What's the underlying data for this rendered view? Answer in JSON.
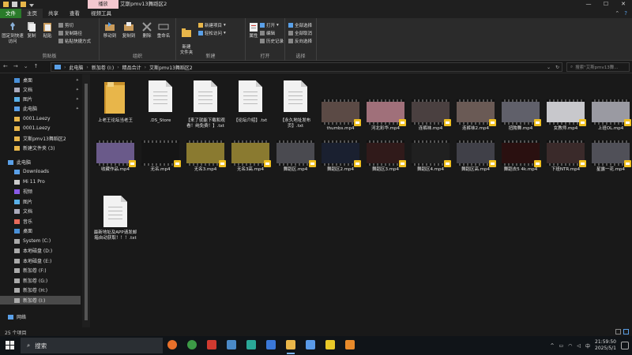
{
  "titlebar": {
    "context_tab": "播放",
    "title": "艾斯pmv13舞蹈区2",
    "minimize": "—",
    "maximize": "☐",
    "close": "✕"
  },
  "ribbon_tabs": [
    "文件",
    "主页",
    "共享",
    "查看",
    "视频工具"
  ],
  "ribbon": {
    "clipboard": {
      "pin": "固定到快速访问",
      "copy": "复制",
      "paste": "粘贴",
      "cut": "剪切",
      "copy_path": "复制路径",
      "paste_shortcut": "粘贴快捷方式",
      "label": "剪贴板"
    },
    "organize": {
      "move_to": "移动到",
      "copy_to": "复制到",
      "delete": "删除",
      "rename": "重命名",
      "label": "组织"
    },
    "new": {
      "new_folder": "新建\n文件夹",
      "new_item": "新建项目",
      "easy_access": "轻松访问",
      "label": "新建"
    },
    "open": {
      "properties": "属性",
      "open": "打开",
      "edit": "编辑",
      "history": "历史记录",
      "label": "打开"
    },
    "select": {
      "select_all": "全部选择",
      "select_none": "全部取消",
      "invert": "反向选择",
      "label": "选择"
    }
  },
  "address": {
    "crumbs": [
      "此电脑",
      "新加卷 (I:)",
      "精品合计",
      "艾斯pmv13舞蹈区2"
    ],
    "search_placeholder": "搜索\"艾斯pmv13舞..."
  },
  "nav": [
    {
      "label": "桌面",
      "pinned": true,
      "icon": "desktop"
    },
    {
      "label": "文档",
      "pinned": true,
      "icon": "doc"
    },
    {
      "label": "图片",
      "pinned": true,
      "icon": "pic"
    },
    {
      "label": "此电脑",
      "pinned": true,
      "icon": "pc"
    },
    {
      "label": "0001.Leezy",
      "pinned": false,
      "icon": "folder"
    },
    {
      "label": "0001.Leezy",
      "pinned": false,
      "icon": "folder"
    },
    {
      "label": "艾斯pmv13舞蹈区2",
      "pinned": false,
      "icon": "folder"
    },
    {
      "label": "新建文件夹 (3)",
      "pinned": false,
      "icon": "folder"
    },
    {
      "label": "此电脑",
      "pinned": false,
      "icon": "pc"
    },
    {
      "label": "Downloads",
      "pinned": false,
      "icon": "dl"
    },
    {
      "label": "Mi 11 Pro",
      "pinned": false,
      "icon": "phone"
    },
    {
      "label": "视频",
      "pinned": false,
      "icon": "video"
    },
    {
      "label": "图片",
      "pinned": false,
      "icon": "pic"
    },
    {
      "label": "文档",
      "pinned": false,
      "icon": "doc"
    },
    {
      "label": "音乐",
      "pinned": false,
      "icon": "music"
    },
    {
      "label": "桌面",
      "pinned": false,
      "icon": "desktop"
    },
    {
      "label": "System (C:)",
      "pinned": false,
      "icon": "drive"
    },
    {
      "label": "本地磁盘 (D:)",
      "pinned": false,
      "icon": "drive"
    },
    {
      "label": "本地磁盘 (E:)",
      "pinned": false,
      "icon": "drive"
    },
    {
      "label": "新加卷 (F:)",
      "pinned": false,
      "icon": "drive"
    },
    {
      "label": "新加卷 (G:)",
      "pinned": false,
      "icon": "drive"
    },
    {
      "label": "新加卷 (H:)",
      "pinned": false,
      "icon": "drive"
    },
    {
      "label": "新加卷 (I:)",
      "pinned": false,
      "icon": "drive",
      "selected": true
    },
    {
      "label": "网络",
      "pinned": false,
      "icon": "net"
    }
  ],
  "files": [
    {
      "name": "上老王论坛当老王",
      "type": "folder"
    },
    {
      "name": ".DS_Store",
      "type": "doc"
    },
    {
      "name": "【来了就能下载和观看！纯免费！】.txt",
      "type": "doc"
    },
    {
      "name": "【论坛介绍】.txt",
      "type": "doc"
    },
    {
      "name": "【永久地址发布页】.txt",
      "type": "doc"
    },
    {
      "name": "thumbs.mp4",
      "type": "video",
      "color": "#5b4a45"
    },
    {
      "name": "河北彩华.mp4",
      "type": "video",
      "color": "#a0707a"
    },
    {
      "name": "连裤袜.mp4",
      "type": "video",
      "color": "#4a4040"
    },
    {
      "name": "连裤袜2.mp4",
      "type": "video",
      "color": "#6a5a55"
    },
    {
      "name": "扭胯舞.mp4",
      "type": "video",
      "color": "#60606a"
    },
    {
      "name": "女教师.mp4",
      "type": "video",
      "color": "#c8c8cc"
    },
    {
      "name": "上班OL.mp4",
      "type": "video",
      "color": "#9a9aa2"
    },
    {
      "name": "收藏作品.mp4",
      "type": "video",
      "color": "#6a5a8a"
    },
    {
      "name": "无名.mp4",
      "type": "video",
      "color": "#151515"
    },
    {
      "name": "无名3.mp4",
      "type": "video",
      "color": "#8a7a30"
    },
    {
      "name": "无名3高.mp4",
      "type": "video",
      "color": "#8a7a30"
    },
    {
      "name": "舞蹈区.mp4",
      "type": "video",
      "color": "#4a4a50"
    },
    {
      "name": "舞蹈区2.mp4",
      "type": "video",
      "color": "#1a2030"
    },
    {
      "name": "舞蹈区3.mp4",
      "type": "video",
      "color": "#301a1a"
    },
    {
      "name": "舞蹈区4.mp4",
      "type": "video",
      "color": "#202020"
    },
    {
      "name": "舞蹈区高.mp4",
      "type": "video",
      "color": "#404048"
    },
    {
      "name": "舞蹈去5 4k.mp4",
      "type": "video",
      "color": "#2a1010"
    },
    {
      "name": "下班NTR.mp4",
      "type": "video",
      "color": "#3a2a2a"
    },
    {
      "name": "星露一花.mp4",
      "type": "video",
      "color": "#505058"
    },
    {
      "name": "最新地址及APP请发邮箱自动获取！！！.txt",
      "type": "doc"
    }
  ],
  "status": {
    "count": "25 个项目"
  },
  "taskbar": {
    "search_label": "搜索",
    "apps": [
      {
        "name": "firefox",
        "color": "#e8702a"
      },
      {
        "name": "chrome",
        "color": "#3c9a46"
      },
      {
        "name": "app-red",
        "color": "#d03a30"
      },
      {
        "name": "app-keyboard",
        "color": "#4a8ac8"
      },
      {
        "name": "app-teal",
        "color": "#2aa898"
      },
      {
        "name": "app-blue",
        "color": "#3a78d8"
      },
      {
        "name": "explorer",
        "color": "#e8b64a",
        "active": true
      },
      {
        "name": "app-link",
        "color": "#5a9ae8"
      },
      {
        "name": "app-yellow",
        "color": "#e8c828"
      },
      {
        "name": "app-search",
        "color": "#e88a2a"
      }
    ],
    "tray_chevron": "^",
    "ime": "中",
    "time": "21:59:50",
    "date": "2025/5/1"
  }
}
